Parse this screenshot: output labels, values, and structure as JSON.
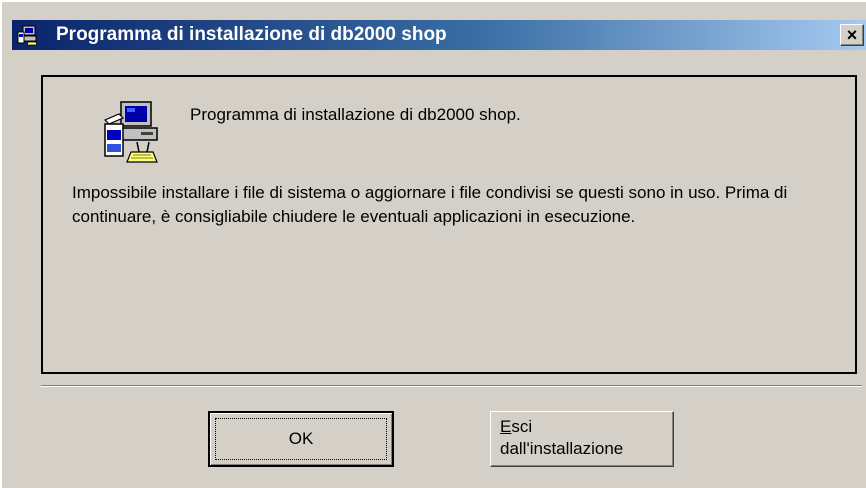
{
  "window": {
    "title": "Programma di installazione di db2000 shop",
    "close_glyph": "×",
    "title_icon": "setup-computer-icon"
  },
  "panel": {
    "icon": "setup-computer-icon",
    "heading": "Programma di installazione di db2000 shop.",
    "message": "Impossibile installare i file di sistema o aggiornare i file condivisi se questi sono in uso. Prima di continuare, è consigliabile chiudere le eventuali applicazioni in esecuzione."
  },
  "buttons": {
    "ok_label": "OK",
    "exit_label_access_key": "E",
    "exit_label_rest_line1": "sci",
    "exit_label_line2": "dall'installazione"
  },
  "colors": {
    "titlebar_start": "#0a246a",
    "titlebar_end": "#a6caf0",
    "face": "#d4d0c8"
  }
}
